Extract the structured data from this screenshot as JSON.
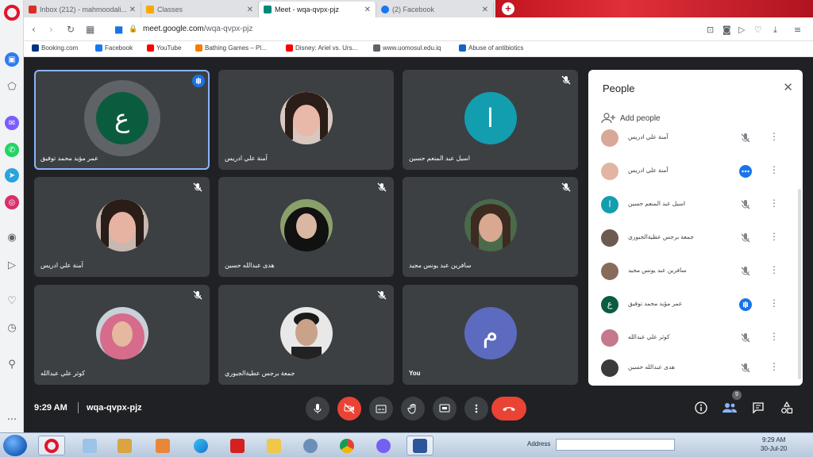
{
  "browser": {
    "tabs": [
      {
        "label": "Inbox (212) - mahmoodali...",
        "favicon_color": "#d93025"
      },
      {
        "label": "Classes",
        "favicon_color": "#f9ab00"
      },
      {
        "label": "Meet - wqa-qvpx-pjz",
        "favicon_color": "#00897b"
      },
      {
        "label": "(2) Facebook",
        "favicon_color": "#1877f2"
      }
    ],
    "url_host": "meet.google.com",
    "url_path": "/wqa-qvpx-pjz",
    "bookmarks": [
      {
        "label": "Booking.com",
        "color": "#003580"
      },
      {
        "label": "Facebook",
        "color": "#1877f2"
      },
      {
        "label": "YouTube",
        "color": "#ff0000"
      },
      {
        "label": "Bathing Games – Pl...",
        "color": "#f57c00"
      },
      {
        "label": "Disney: Ariel vs. Urs...",
        "color": "#ff0000"
      },
      {
        "label": "www.uomosul.edu.iq",
        "color": "#5f6368"
      },
      {
        "label": "Abuse of antibiotics",
        "color": "#1565c0"
      }
    ]
  },
  "meet": {
    "tiles": [
      {
        "name": "عمر مؤيد محمد توفيق",
        "type": "letter",
        "letter": "ع",
        "color": "#0b5c3e",
        "speaking": true
      },
      {
        "name": "آمنة علي ادريس",
        "type": "photo",
        "skin": "#e8b9a8",
        "hair": "#2b1d18"
      },
      {
        "name": "اسيل عبد المنعم حسين",
        "type": "letter",
        "letter": "ا",
        "color": "#129eaf"
      },
      {
        "name": "آمنة علي ادريس",
        "type": "photo",
        "skin": "#e6b2a2",
        "hair": "#2a1c17"
      },
      {
        "name": "هدى عبدالله حسين",
        "type": "photo",
        "skin": "#d9b7a0",
        "hair": "#111111"
      },
      {
        "name": "سافرين عبد يونس مجيد",
        "type": "photo",
        "skin": "#d8a890",
        "hair": "#3d2a20"
      },
      {
        "name": "كوثر علي عبدالله",
        "type": "photo",
        "skin": "#e5b8a0",
        "hair": "#d66b8c"
      },
      {
        "name": "جمعة برجس عطيةالجبوري",
        "type": "photo",
        "skin": "#c9a28a",
        "hair": "#1a1a1a"
      },
      {
        "name": "You",
        "type": "letter",
        "letter": "م",
        "color": "#5c6bc0"
      }
    ],
    "people_panel": {
      "title": "People",
      "add_label": "Add people",
      "rows": [
        {
          "name": "آمنة علي ادريس",
          "av": "photo",
          "color": "#d8a898",
          "mic": "muted"
        },
        {
          "name": "آمنة علي ادريس",
          "av": "photo",
          "color": "#e2b4a4",
          "mic": "more"
        },
        {
          "name": "اسيل عبد المنعم حسين",
          "av": "letter",
          "letter": "ا",
          "color": "#129eaf",
          "mic": "muted"
        },
        {
          "name": "جمعة برجس عطيةالجبوري",
          "av": "photo",
          "color": "#6d5a50",
          "mic": "muted"
        },
        {
          "name": "سافرين عبد يونس مجيد",
          "av": "photo",
          "color": "#8a6a5a",
          "mic": "muted"
        },
        {
          "name": "عمر مؤيد محمد توفيق",
          "av": "letter",
          "letter": "ع",
          "color": "#0b5c3e",
          "mic": "speaking"
        },
        {
          "name": "كوثر علي عبدالله",
          "av": "photo",
          "color": "#c47a8c",
          "mic": "muted"
        },
        {
          "name": "هدى عبدالله حسين",
          "av": "photo",
          "color": "#3a3a3a",
          "mic": "muted"
        }
      ]
    },
    "bottom": {
      "time": "9:29 AM",
      "code": "wqa-qvpx-pjz",
      "participant_count": "9"
    }
  },
  "taskbar": {
    "address_label": "Address",
    "time": "9:29 AM",
    "date": "30-Jul-20"
  }
}
